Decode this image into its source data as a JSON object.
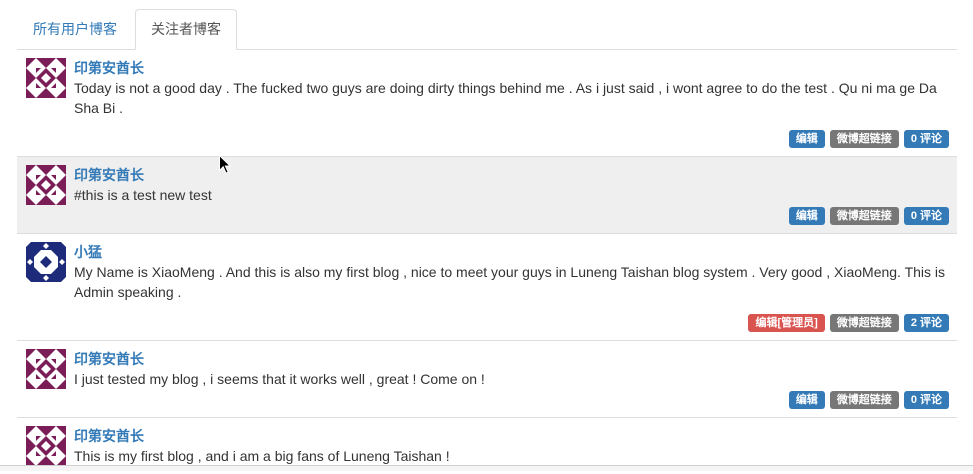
{
  "tabs": [
    {
      "label": "所有用户博客",
      "active": false
    },
    {
      "label": "关注者博客",
      "active": true
    }
  ],
  "posts": [
    {
      "author": "印第安酋长",
      "avatar_icon": "identicon-maroon-avatar",
      "text": "Today is not a good day . The fucked two guys are doing dirty things behind me . As i just said , i wont agree to do the test . Qu ni ma ge Da Sha Bi .",
      "highlighted": false,
      "actions": [
        {
          "label": "编辑",
          "color": "#337ab7"
        },
        {
          "label": "微博超链接",
          "color": "#777777"
        },
        {
          "label": "0 评论",
          "color": "#337ab7"
        }
      ]
    },
    {
      "author": "印第安酋长",
      "avatar_icon": "identicon-maroon-avatar",
      "text": "#this is a test new test",
      "highlighted": true,
      "actions": [
        {
          "label": "编辑",
          "color": "#337ab7"
        },
        {
          "label": "微博超链接",
          "color": "#777777"
        },
        {
          "label": "0 评论",
          "color": "#337ab7"
        }
      ]
    },
    {
      "author": "小猛",
      "avatar_icon": "identicon-navy-avatar",
      "text": "My Name is XiaoMeng . And this is also my first blog , nice to meet your guys in Luneng Taishan blog system . Very good , XiaoMeng. This is Admin speaking .",
      "highlighted": false,
      "actions": [
        {
          "label": "编辑[管理员]",
          "color": "#d9534f"
        },
        {
          "label": "微博超链接",
          "color": "#777777"
        },
        {
          "label": "2 评论",
          "color": "#337ab7"
        }
      ]
    },
    {
      "author": "印第安酋长",
      "avatar_icon": "identicon-maroon-avatar",
      "text": "I just tested my blog , i seems that it works well , great ! Come on !",
      "highlighted": false,
      "actions": [
        {
          "label": "编辑",
          "color": "#337ab7"
        },
        {
          "label": "微博超链接",
          "color": "#777777"
        },
        {
          "label": "0 评论",
          "color": "#337ab7"
        }
      ]
    },
    {
      "author": "印第安酋长",
      "avatar_icon": "identicon-maroon-avatar",
      "text": "This is my first blog , and i am a big fans of Luneng Taishan !",
      "highlighted": false
    }
  ],
  "colors": {
    "link": "#337ab7",
    "active_tab_text": "#555555",
    "body_text": "#333333",
    "highlight_bg": "#efefef",
    "border": "#dddddd",
    "identicon_maroon": "#7b1d56",
    "identicon_navy": "#1e2a7a"
  },
  "cursor_icon": "arrow-cursor-icon"
}
